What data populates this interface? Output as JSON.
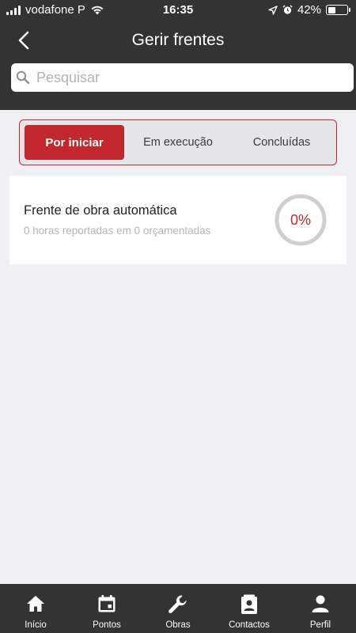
{
  "status_bar": {
    "carrier": "vodafone P",
    "time": "16:35",
    "battery": "42%",
    "battery_level": 0.42
  },
  "header": {
    "title": "Gerir frentes",
    "back_icon": "chevron-left-icon"
  },
  "search": {
    "placeholder": "Pesquisar",
    "value": "",
    "icon": "search-icon"
  },
  "segments": [
    {
      "label": "Por iniciar",
      "active": true
    },
    {
      "label": "Em execução",
      "active": false
    },
    {
      "label": "Concluídas",
      "active": false
    }
  ],
  "work_fronts": [
    {
      "name": "Frente de obra automática",
      "detail": "0 horas reportadas em 0 orçamentadas",
      "progress_label": "0%",
      "progress": 0
    }
  ],
  "tabbar": {
    "items": [
      {
        "label": "Início",
        "icon": "home-icon"
      },
      {
        "label": "Pontos",
        "icon": "calendar-icon"
      },
      {
        "label": "Obras",
        "icon": "wrench-icon"
      },
      {
        "label": "Contactos",
        "icon": "contacts-icon"
      },
      {
        "label": "Perfil",
        "icon": "person-icon"
      }
    ]
  },
  "colors": {
    "accent": "#c1272d",
    "header_bg": "#333333",
    "page_bg": "#efeff4"
  }
}
